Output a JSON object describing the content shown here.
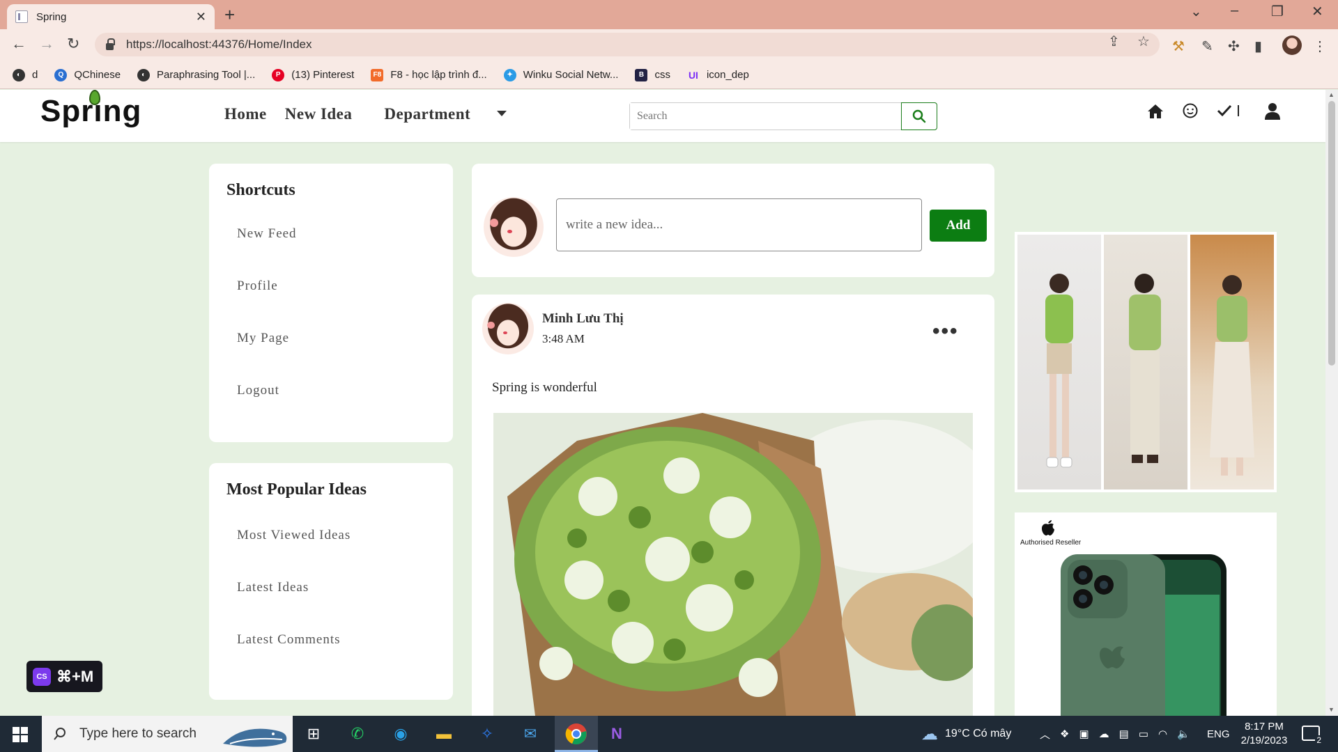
{
  "browser": {
    "tab_title": "Spring",
    "url": "https://localhost:44376/Home/Index",
    "bookmarks": [
      {
        "label": "d",
        "icon": "globe-icon",
        "color": "#333333"
      },
      {
        "label": "QChinese",
        "icon": "qchinese-icon",
        "color": "#2a6fd1"
      },
      {
        "label": "Paraphrasing Tool |...",
        "icon": "globe-icon",
        "color": "#333333"
      },
      {
        "label": "(13) Pinterest",
        "icon": "pinterest-icon",
        "color": "#e60023"
      },
      {
        "label": "F8 - học lập trình đ...",
        "icon": "f8-icon",
        "color": "#f26b2a"
      },
      {
        "label": "Winku Social Netw...",
        "icon": "bird-icon",
        "color": "#2a9be6"
      },
      {
        "label": "css",
        "icon": "bootstrap-icon",
        "color": "#222244"
      },
      {
        "label": "icon_dep",
        "icon": "ui-icon",
        "color": "#7b2ff7"
      }
    ]
  },
  "site": {
    "logo_text": "Spring",
    "nav": {
      "home": "Home",
      "new_idea": "New Idea",
      "department": "Department"
    },
    "search_placeholder": "Search",
    "brand_green": "#0c7d12",
    "background": "#e6f1e1"
  },
  "shortcuts": {
    "title": "Shortcuts",
    "items": [
      "New Feed",
      "Profile",
      "My Page",
      "Logout"
    ]
  },
  "popular": {
    "title": "Most Popular Ideas",
    "items": [
      "Most Viewed Ideas",
      "Latest Ideas",
      "Latest Comments"
    ]
  },
  "composer": {
    "placeholder": "write a new idea...",
    "add_label": "Add"
  },
  "post": {
    "author": "Minh Lưu Thị",
    "time": "3:48 AM",
    "text": "Spring is wonderful",
    "menu": "•••"
  },
  "ads": {
    "apple_reseller": "Authorised Reseller"
  },
  "cs_badge": {
    "logo": "CS",
    "shortcut": "⌘+M"
  },
  "taskbar": {
    "search_placeholder": "Type here to search",
    "weather": "19°C  Có mây",
    "language": "ENG",
    "time": "8:17 PM",
    "date": "2/19/2023",
    "notifications": "2"
  }
}
